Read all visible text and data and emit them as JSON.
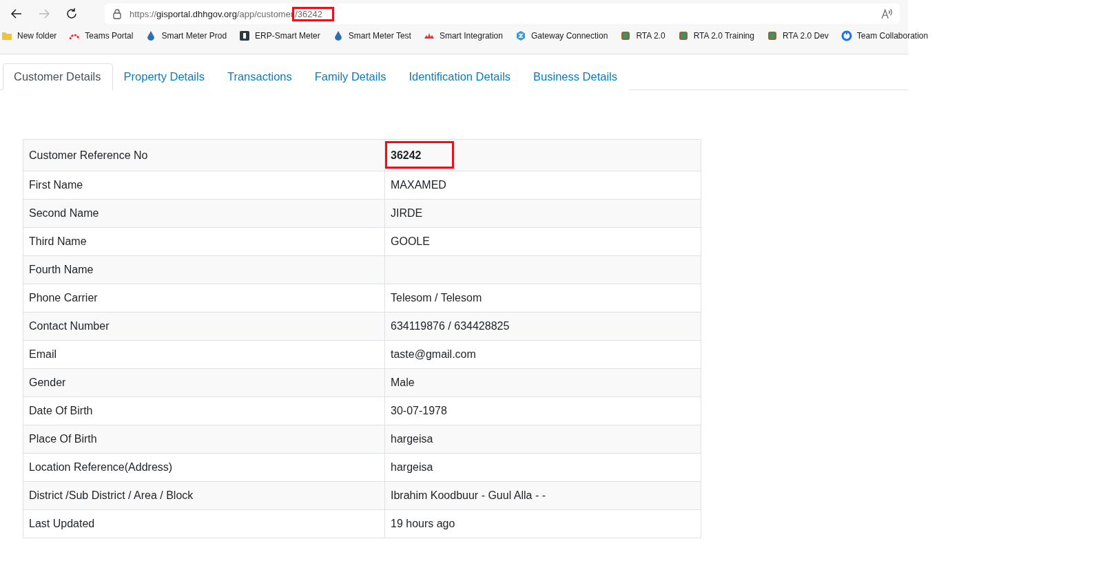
{
  "browser": {
    "url_plain": "https://",
    "url_host": "gisportal.dhhgov.org",
    "url_path": "/app/customer",
    "url_marked": "/36242"
  },
  "bookmarks": [
    {
      "label": "New folder",
      "kind": "folder"
    },
    {
      "label": "Teams Portal",
      "kind": "gauge"
    },
    {
      "label": "Smart Meter Prod",
      "kind": "drop"
    },
    {
      "label": "ERP-Smart Meter",
      "kind": "tile"
    },
    {
      "label": "Smart Meter Test",
      "kind": "drop"
    },
    {
      "label": "Smart Integration",
      "kind": "lotus"
    },
    {
      "label": "Gateway Connection",
      "kind": "hex"
    },
    {
      "label": "RTA 2.0",
      "kind": "emblem"
    },
    {
      "label": "RTA 2.0 Training",
      "kind": "emblem"
    },
    {
      "label": "RTA 2.0 Dev",
      "kind": "emblem"
    },
    {
      "label": "Team Collaboration",
      "kind": "ring"
    }
  ],
  "tabs": [
    {
      "label": "Customer Details",
      "selected": true
    },
    {
      "label": "Property Details",
      "selected": false
    },
    {
      "label": "Transactions",
      "selected": false
    },
    {
      "label": "Family Details",
      "selected": false
    },
    {
      "label": "Identification Details",
      "selected": false
    },
    {
      "label": "Business Details",
      "selected": false
    }
  ],
  "table": {
    "rows": [
      {
        "label": "Customer Reference No",
        "value": "36242",
        "highlighted": true
      },
      {
        "label": "First Name",
        "value": "MAXAMED",
        "highlighted": false
      },
      {
        "label": "Second Name",
        "value": "JIRDE",
        "highlighted": false
      },
      {
        "label": "Third Name",
        "value": "GOOLE",
        "highlighted": false
      },
      {
        "label": "Fourth Name",
        "highlighted": false
      },
      {
        "label": "Phone Carrier",
        "value": "Telesom / Telesom",
        "highlighted": false
      },
      {
        "label": "Contact Number",
        "value": "634119876 / 634428825",
        "highlighted": false
      },
      {
        "label": "Email",
        "value": "taste@gmail.com",
        "highlighted": false
      },
      {
        "label": "Gender",
        "value": "Male",
        "highlighted": false
      },
      {
        "label": "Date Of Birth",
        "value": "30-07-1978",
        "highlighted": false
      },
      {
        "label": "Place Of Birth",
        "value": "hargeisa",
        "highlighted": false
      },
      {
        "label": "Location Reference(Address)",
        "value": "hargeisa",
        "highlighted": false
      },
      {
        "label": "District /Sub District / Area / Block",
        "value": "Ibrahim Koodbuur - Guul Alla - -",
        "highlighted": false
      },
      {
        "label": "Last Updated",
        "value": "19 hours ago",
        "highlighted": false
      }
    ]
  }
}
